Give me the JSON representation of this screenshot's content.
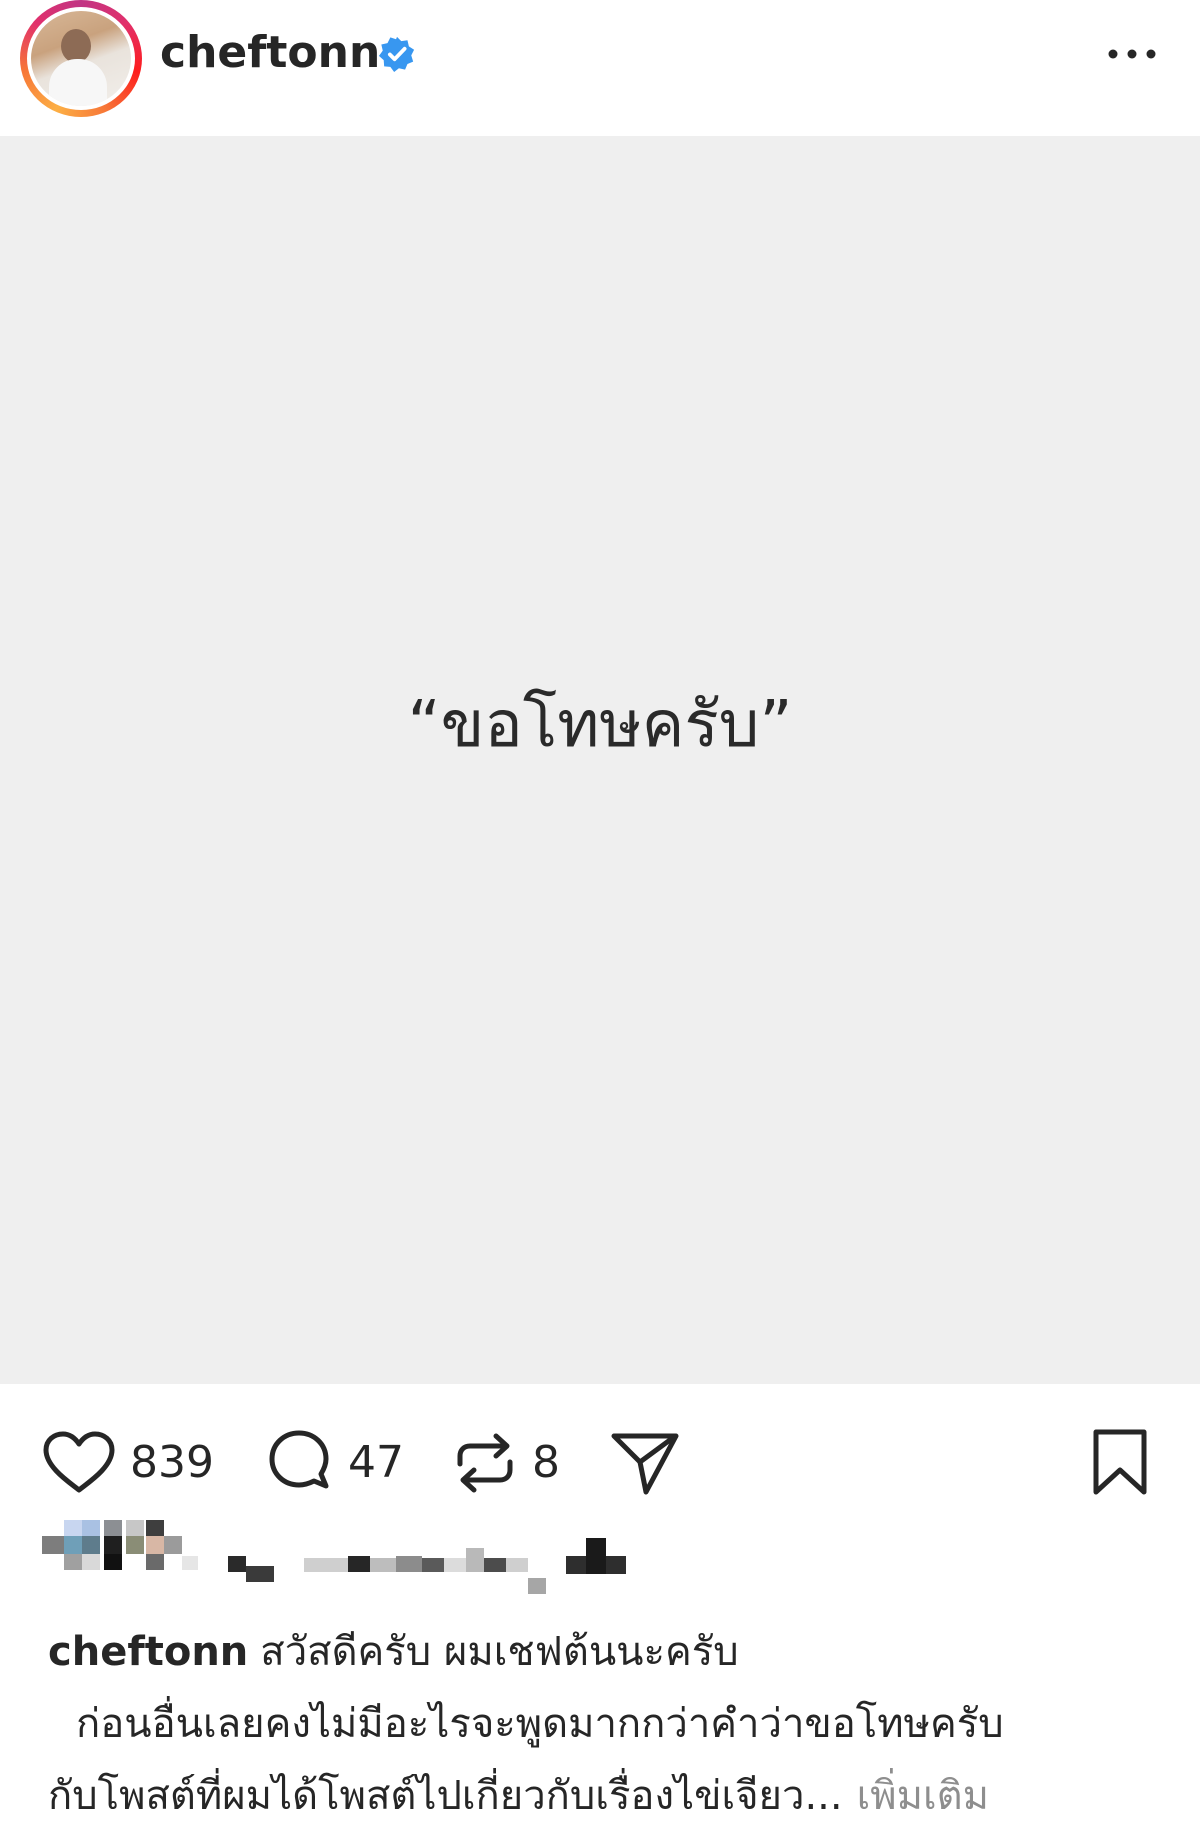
{
  "header": {
    "username": "cheftonn",
    "verified_icon": "verified-badge-icon",
    "more_icon": "more-horizontal-icon"
  },
  "post": {
    "image_text": "“ขอโทษครับ”",
    "background": "#efefef"
  },
  "actions": {
    "likes": "839",
    "comments": "47",
    "reposts": "8",
    "icons": [
      "heart-icon",
      "comment-icon",
      "repost-icon",
      "share-icon",
      "bookmark-icon"
    ]
  },
  "caption": {
    "username": "cheftonn",
    "line1": "สวัสดีครับ ผมเชฟต้นนะครับ",
    "line2": "ก่อนอื่นเลยคงไม่มีอะไรจะพูดมากกว่าคำว่าขอโทษครับ",
    "line3": "กับโพสต์ที่ผมได้โพสต์ไปเกี่ยวกับเรื่องไข่เจียว...",
    "more_label": "เพิ่มเติม"
  },
  "colors": {
    "verified": "#3897f0",
    "text": "#262626",
    "muted": "#8e8e8e"
  }
}
